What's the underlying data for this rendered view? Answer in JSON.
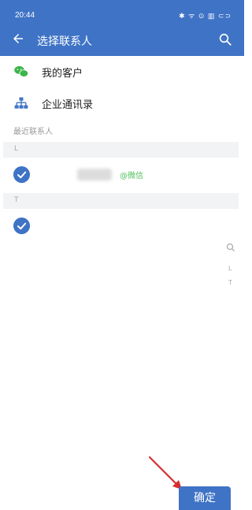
{
  "status_bar": {
    "time": "20:44",
    "icons_text": "✱ ᯤ ⊙ ▥ ⊂⊃"
  },
  "header": {
    "title": "选择联系人",
    "back_icon": "arrow-left-icon",
    "search_icon": "search-icon"
  },
  "menu": [
    {
      "label": "我的客户",
      "icon": "wechat-icon"
    },
    {
      "label": "企业通讯录",
      "icon": "org-chart-icon"
    }
  ],
  "recent_label": "最近联系人",
  "groups": [
    {
      "letter": "L",
      "contacts": [
        {
          "checked": true,
          "tag": "@微信"
        }
      ]
    },
    {
      "letter": "T",
      "contacts": [
        {
          "checked": true
        }
      ]
    }
  ],
  "index_bar": {
    "letters": [
      "L",
      "T"
    ]
  },
  "confirm_button": {
    "label": "确定"
  },
  "colors": {
    "primary": "#3f73c5",
    "wechat_green": "#4fbf5a",
    "annotation_arrow": "#d32f2f"
  }
}
